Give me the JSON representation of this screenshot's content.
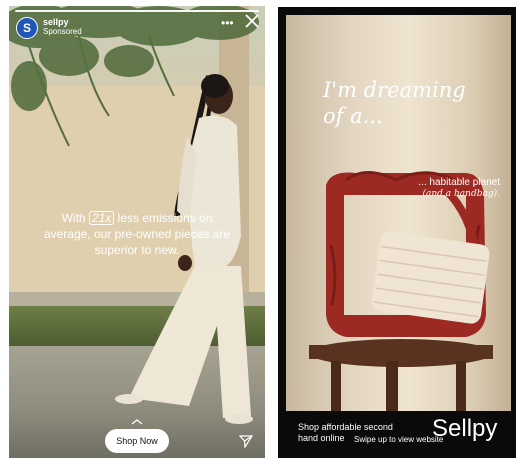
{
  "left_story": {
    "brand": {
      "logo_letter": "S",
      "name": "sellpy",
      "sponsored": "Sponsored"
    },
    "caption": {
      "pre": "With",
      "boxed": "21x",
      "post": "less emissions on average, our pre-owned pieces are superior to new."
    },
    "cta": "Shop Now",
    "icons": [
      "more-icon",
      "close-icon",
      "chevron-up-icon",
      "send-icon"
    ]
  },
  "right_story": {
    "headline": "I'm dreaming of a...",
    "subline": "... habitable planet",
    "subline_italic": "(and a handbag).",
    "cta_text": "Shop affordable second hand online",
    "swipe_text": "Swipe up to view website",
    "logo": "Sellpy"
  },
  "colors": {
    "brand_blue": "#1f56b8",
    "story_dark": "#0a0a0a",
    "bag_red": "#9c2a22"
  }
}
